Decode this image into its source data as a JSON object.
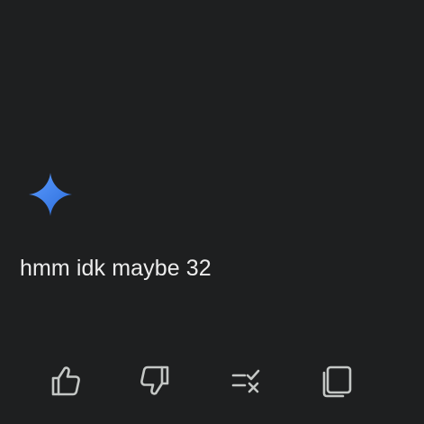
{
  "response": {
    "text": "hmm idk maybe 32",
    "avatar_icon": "sparkle-icon"
  },
  "actions": [
    {
      "name": "good-response-button",
      "icon": "thumbs-up-icon"
    },
    {
      "name": "bad-response-button",
      "icon": "thumbs-down-icon"
    },
    {
      "name": "modify-response-button",
      "icon": "modify-response-icon"
    },
    {
      "name": "copy-button",
      "icon": "copy-icon"
    }
  ],
  "colors": {
    "background": "#1e1f20",
    "text": "#ececec",
    "icon": "#c4c7c5",
    "sparkle_start": "#4285f4",
    "sparkle_end": "#2b6cd9"
  }
}
